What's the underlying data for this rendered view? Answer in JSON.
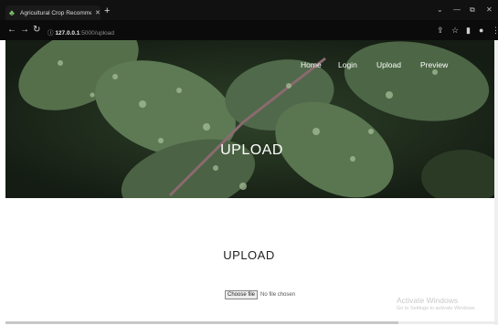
{
  "browser": {
    "tab_title": "Agricultural Crop Recommendat",
    "tab_close": "✕",
    "new_tab": "+",
    "address_host": "127.0.0.1",
    "address_path": ":5000/upload",
    "window_controls": [
      "⌄",
      "—",
      "⧉",
      "✕"
    ]
  },
  "nav": {
    "home": "Home",
    "login": "Login",
    "upload": "Upload",
    "preview": "Preview"
  },
  "hero": {
    "title": "UPLOAD"
  },
  "main": {
    "title": "UPLOAD",
    "file_button": "Choose file",
    "file_status": "No file chosen"
  },
  "watermark": {
    "line1": "Activate Windows",
    "line2": "Go to Settings to activate Windows."
  },
  "colors": {
    "toolbar": "#0b0b0b",
    "hero_bg": "#1e2b1c",
    "leaf": "#4f6b45"
  },
  "icons": [
    "back-arrow-icon",
    "forward-arrow-icon",
    "reload-icon",
    "info-icon",
    "share-icon",
    "star-icon",
    "sidebar-icon",
    "profile-icon",
    "menu-icon"
  ]
}
